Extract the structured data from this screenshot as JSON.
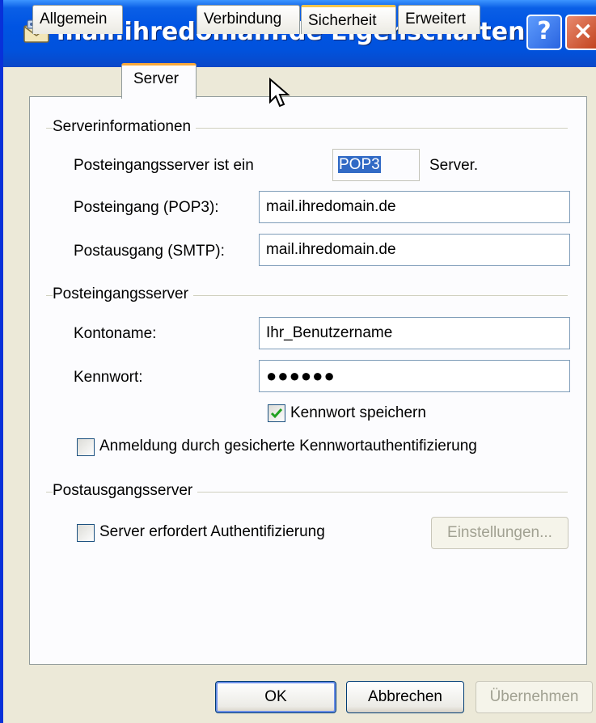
{
  "window": {
    "title": "mail.ihredomain.de Eigenschaften",
    "help_label": "?",
    "close_label": "×"
  },
  "tabs": [
    {
      "label": "Allgemein",
      "active": false
    },
    {
      "label": "Server",
      "active": true
    },
    {
      "label": "Verbindung",
      "active": false
    },
    {
      "label": "Sicherheit",
      "active": false
    },
    {
      "label": "Erweitert",
      "active": false
    }
  ],
  "server_info": {
    "group_title": "Serverinformationen",
    "incoming_type_label": "Posteingangsserver ist ein",
    "incoming_type_value": "POP3",
    "incoming_type_suffix": "Server.",
    "incoming_label": "Posteingang (POP3):",
    "incoming_value": "mail.ihredomain.de",
    "outgoing_label": "Postausgang (SMTP):",
    "outgoing_value": "mail.ihredomain.de"
  },
  "incoming_server": {
    "group_title": "Posteingangsserver",
    "account_label": "Kontoname:",
    "account_value": "Ihr_Benutzername",
    "password_label": "Kennwort:",
    "password_value": "●●●●●●",
    "remember_password_label": "Kennwort speichern",
    "remember_password_checked": true,
    "spa_label": "Anmeldung durch gesicherte Kennwortauthentifizierung",
    "spa_checked": false
  },
  "outgoing_server": {
    "group_title": "Postausgangsserver",
    "auth_required_label": "Server erfordert Authentifizierung",
    "auth_required_checked": false,
    "settings_button": "Einstellungen..."
  },
  "buttons": {
    "ok": "OK",
    "cancel": "Abbrechen",
    "apply": "Übernehmen"
  },
  "colors": {
    "title_bar": "#0054e3",
    "dialog_bg": "#ece9d8",
    "selection": "#316ac5",
    "checkmark": "#21a121"
  }
}
